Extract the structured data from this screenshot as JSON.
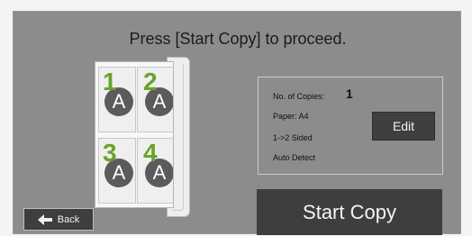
{
  "screen": {
    "title": "Press [Start Copy] to proceed."
  },
  "preview": {
    "pages": [
      {
        "number": "1",
        "letter": "A"
      },
      {
        "number": "2",
        "letter": "A"
      },
      {
        "number": "3",
        "letter": "A"
      },
      {
        "number": "4",
        "letter": "A"
      }
    ]
  },
  "settings": {
    "copies_label": "No. of Copies:",
    "copies_value": "1",
    "paper": "Paper: A4",
    "sides": "1->2 Sided",
    "detect": "Auto Detect",
    "edit_label": "Edit"
  },
  "actions": {
    "start_label": "Start Copy",
    "back_label": "Back"
  },
  "colors": {
    "accent_number": "#6aa22c",
    "button_dark": "#3e3e3e",
    "panel": "#8c8c8c"
  },
  "icons": {
    "back": "arrow-left-icon"
  }
}
